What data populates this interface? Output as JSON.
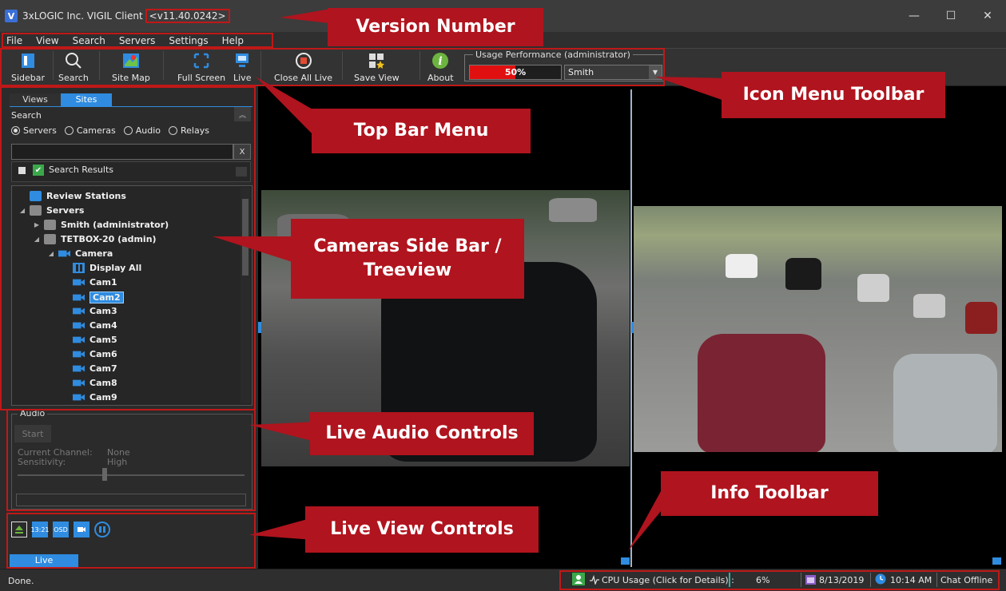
{
  "window": {
    "title": "3xLOGIC Inc. VIGIL Client",
    "version": "<v11.40.0242>",
    "app_icon": "V",
    "minimize": "—",
    "maximize": "☐",
    "close": "✕"
  },
  "menu": [
    "File",
    "View",
    "Search",
    "Servers",
    "Settings",
    "Help"
  ],
  "toolbar": {
    "buttons": [
      {
        "label": "Sidebar",
        "icon": "sidebar-icon"
      },
      {
        "label": "Search",
        "icon": "search-icon"
      },
      {
        "label": "Site Map",
        "icon": "site-map-icon"
      },
      {
        "label": "Full Screen",
        "icon": "fullscreen-icon"
      },
      {
        "label": "Live",
        "icon": "live-icon"
      },
      {
        "label": "Close All Live",
        "icon": "close-all-live-icon"
      },
      {
        "label": "Save View",
        "icon": "save-view-icon"
      },
      {
        "label": "About",
        "icon": "about-icon"
      }
    ],
    "usage": {
      "title": "Usage Performance (administrator)",
      "percent_label": "50%",
      "percent_value": 0.5,
      "server": "Smith",
      "bar_color": "#e01010"
    }
  },
  "sidebar": {
    "tabs": [
      "Views",
      "Sites"
    ],
    "active_tab": "Sites",
    "search_label": "Search",
    "clear_label": "X",
    "filters": [
      {
        "label": "Servers",
        "selected": true
      },
      {
        "label": "Cameras",
        "selected": false
      },
      {
        "label": "Audio",
        "selected": false
      },
      {
        "label": "Relays",
        "selected": false
      }
    ],
    "search_results_label": "Search Results",
    "tree": {
      "review_stations": "Review Stations",
      "servers": "Servers",
      "server1": "Smith (administrator)",
      "server2": "TETBOX-20 (admin)",
      "camera_group": "Camera",
      "display_all": "Display All",
      "cameras": [
        "Cam1",
        "Cam2",
        "Cam3",
        "Cam4",
        "Cam5",
        "Cam6",
        "Cam7",
        "Cam8",
        "Cam9"
      ],
      "selected_camera": "Cam2"
    },
    "audio": {
      "title": "Audio",
      "start_label": "Start",
      "channel_label": "Current Channel:",
      "channel_value": "None",
      "sensitivity_label": "Sensitivity:",
      "sensitivity_value": "High"
    },
    "live_controls": {
      "time_label": "13:21",
      "osd_label": "OSD",
      "tab_label": "Live"
    }
  },
  "statusbar": {
    "status": "Done.",
    "cpu_label": "CPU Usage (Click for Details) :",
    "cpu_value": "6%",
    "date": "8/13/2019",
    "time": "10:14 AM",
    "chat": "Chat Offline"
  },
  "callouts": {
    "version": "Version Number",
    "icon_toolbar": "Icon Menu Toolbar",
    "top_bar": "Top Bar Menu",
    "sidebar_line1": "Cameras Side Bar /",
    "sidebar_line2": "Treeview",
    "audio": "Live Audio Controls",
    "info": "Info Toolbar",
    "live": "Live View Controls"
  },
  "colors": {
    "accent": "#2f8ce0",
    "callout": "#b0141e",
    "highlight_outline": "#c01818"
  }
}
